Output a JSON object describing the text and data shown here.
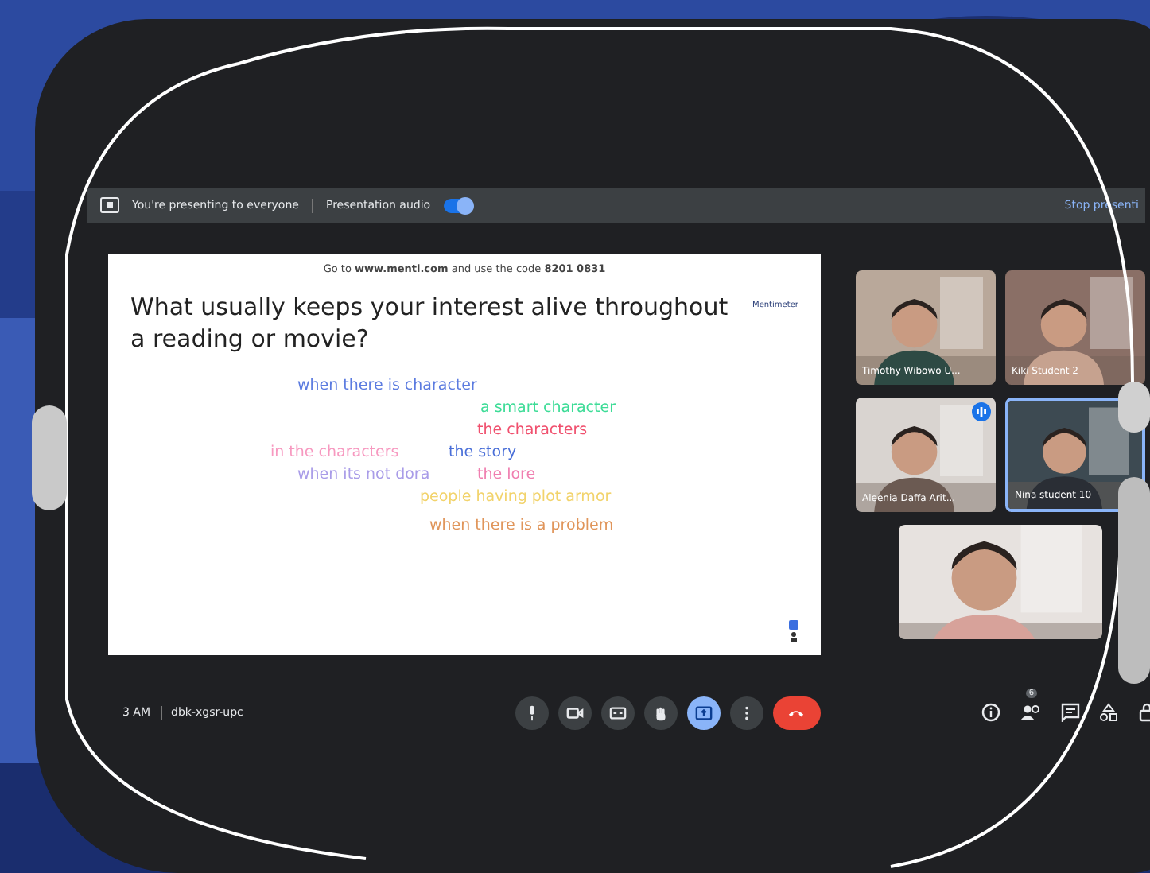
{
  "presenting_bar": {
    "message": "You're presenting to everyone",
    "audio_label": "Presentation audio",
    "audio_on": true,
    "stop_button": "Stop presenti"
  },
  "slide": {
    "instruction": "Go to **www.menti.com** and use the code **8201 0831**",
    "question": "What usually keeps your interest alive throughout a reading or movie?",
    "brand": "Mentimeter",
    "words": [
      {
        "text": "when there is character",
        "color": "#5b7be0"
      },
      {
        "text": "a smart character",
        "color": "#3ddc97"
      },
      {
        "text": "the characters",
        "color": "#f0506e"
      },
      {
        "text": "in the characters",
        "color": "#f799c0"
      },
      {
        "text": "the story",
        "color": "#4a6fd8"
      },
      {
        "text": "when its not dora",
        "color": "#a99ce8"
      },
      {
        "text": "the lore",
        "color": "#f07fb0"
      },
      {
        "text": "people having plot armor",
        "color": "#f2d36b"
      },
      {
        "text": "when there is a problem",
        "color": "#e0955a"
      }
    ]
  },
  "participants": [
    {
      "name": "Timothy Wibowo U...",
      "speaking": false,
      "highlighted": false
    },
    {
      "name": "Kiki Student 2",
      "speaking": false,
      "highlighted": false
    },
    {
      "name": "Aleenia Daffa Arit...",
      "speaking": true,
      "highlighted": false
    },
    {
      "name": "Nina student 10",
      "speaking": false,
      "highlighted": true
    },
    {
      "highlighted": false
    }
  ],
  "call_bar": {
    "time": "3 AM",
    "meeting_code": "dbk-xgsr-upc",
    "controls": [
      {
        "kind": "mic",
        "selected": false
      },
      {
        "kind": "camera",
        "selected": false
      },
      {
        "kind": "captions",
        "selected": false
      },
      {
        "kind": "hand",
        "selected": false
      },
      {
        "kind": "present",
        "selected": true
      },
      {
        "kind": "more",
        "selected": false
      },
      {
        "kind": "end",
        "selected": false
      }
    ],
    "people_count": "6"
  }
}
